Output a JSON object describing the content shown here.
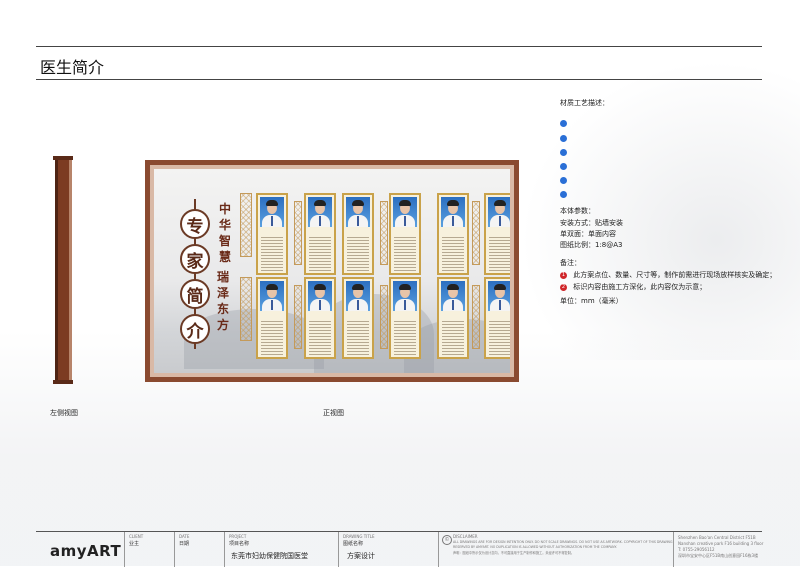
{
  "page_title": "医生简介",
  "board": {
    "seal_chars": [
      "专",
      "家",
      "简",
      "介"
    ],
    "slogan_left": [
      "中",
      "华",
      "智",
      "慧"
    ],
    "slogan_right": [
      "瑞",
      "泽",
      "东",
      "方"
    ]
  },
  "views": {
    "left": "左侧视图",
    "front": "正视图"
  },
  "notes": {
    "material_title": "材质工艺描述：",
    "params_title": "本体参数：",
    "params": [
      "安装方式：贴墙安装",
      "单双面：单面内容",
      "图纸比例：1:8@A3"
    ],
    "remarks_title": "备注：",
    "remarks": [
      {
        "num": "1",
        "text": "此方案点位、数量、尺寸等，制作前需进行现场放样核实及确定；"
      },
      {
        "num": "2",
        "text": "标识内容由施工方深化，此内容仅为示意；"
      }
    ],
    "unit": "单位：mm（毫米）"
  },
  "title_block": {
    "logo": "amyART",
    "client_label": "CLIENT",
    "client_value": "业主",
    "date_label": "DATE",
    "date_value": "日期",
    "project_label": "PROJECT",
    "project_sub": "项目名称",
    "project_value": "东莞市妇幼保健院国医堂",
    "drawing_label": "DRAWING TITLE",
    "drawing_sub": "图纸名称",
    "drawing_value": "方案设计",
    "disclaimer_label": "DISCLAIMER",
    "disclaimer_line1": "ALL DRAWINGS ARE FOR DESIGN INTENTION ONLY. DO NOT SCALE DRAWINGS. DO NOT USE AS ARTWORK. COPYRIGHT OF THIS DRAWING",
    "disclaimer_line2": "RESERVED BY AMYART. NO DUPLICATION IS ALLOWED WITHOUT AUTHORIZATION FROM THE COMPANY.",
    "disclaimer_line3": "声明：图纸中所示仅为设计意向，不可直接用于生产制作和施工。未经许可不得复制。",
    "company_line1": "Shenzhen Bao'an Central District F51B",
    "company_line2": "Nanshan creative park F16 building 3 floor",
    "company_line3": "T: 0755-29056112",
    "company_line4": "深圳市宝安中心区F51B南山创意园F16栋3楼"
  }
}
